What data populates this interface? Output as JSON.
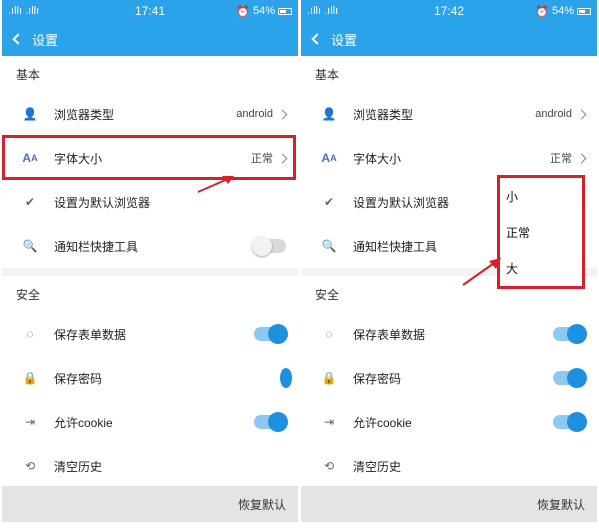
{
  "screens": [
    {
      "status": {
        "signal": ".ıllı .ıllı",
        "time": "17:41",
        "battery": "54%"
      },
      "header": {
        "title": "设置"
      },
      "sections": {
        "basic": "基本",
        "security": "安全"
      },
      "rows": {
        "browser_type": {
          "label": "浏览器类型",
          "value": "android"
        },
        "font_size": {
          "label": "字体大小",
          "value": "正常"
        },
        "default_browser": {
          "label": "设置为默认浏览器"
        },
        "notify_tool": {
          "label": "通知栏快捷工具"
        },
        "save_form": {
          "label": "保存表单数据"
        },
        "save_password": {
          "label": "保存密码"
        },
        "allow_cookie": {
          "label": "允许cookie"
        },
        "clear_history": {
          "label": "清空历史"
        }
      },
      "bottom": {
        "restore_default": "恢复默认"
      }
    },
    {
      "status": {
        "signal": ".ıllı .ıllı",
        "time": "17:42",
        "battery": "54%"
      },
      "header": {
        "title": "设置"
      },
      "sections": {
        "basic": "基本",
        "security": "安全"
      },
      "rows": {
        "browser_type": {
          "label": "浏览器类型",
          "value": "android"
        },
        "font_size": {
          "label": "字体大小",
          "value": "正常"
        },
        "default_browser": {
          "label": "设置为默认浏览器"
        },
        "notify_tool": {
          "label": "通知栏快捷工具"
        },
        "save_form": {
          "label": "保存表单数据"
        },
        "save_password": {
          "label": "保存密码"
        },
        "allow_cookie": {
          "label": "允许cookie"
        },
        "clear_history": {
          "label": "清空历史"
        }
      },
      "bottom": {
        "restore_default": "恢复默认"
      },
      "font_size_popup": {
        "options": [
          "小",
          "正常",
          "大"
        ]
      }
    }
  ],
  "colors": {
    "accent": "#2aa3ea",
    "highlight": "#d8202a",
    "toggle_on": "#1e90e0"
  }
}
